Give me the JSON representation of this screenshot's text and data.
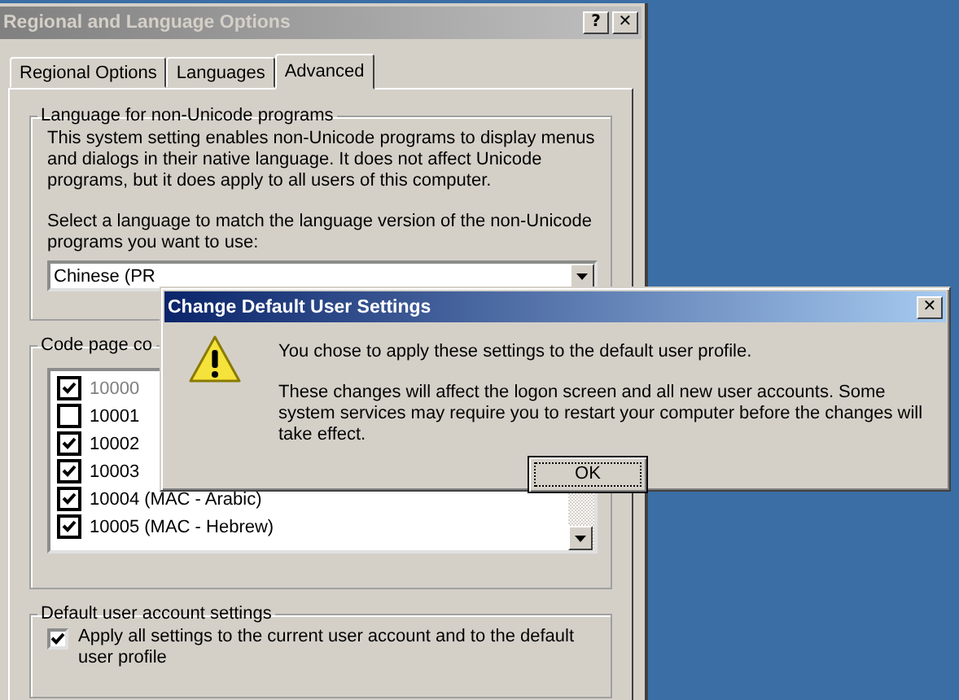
{
  "window": {
    "title": "Regional and Language Options",
    "help_button": "?",
    "close_button": "✕"
  },
  "tabs": [
    {
      "label": "Regional Options",
      "selected": false
    },
    {
      "label": "Languages",
      "selected": false
    },
    {
      "label": "Advanced",
      "selected": true
    }
  ],
  "non_unicode_group": {
    "title": "Language for non-Unicode programs",
    "description": "This system setting enables non-Unicode programs to display menus and dialogs in their native language. It does not affect Unicode programs, but it does apply to all users of this computer.",
    "prompt": "Select a language to match the language version of the non-Unicode programs you want to use:",
    "language_value": "Chinese (PR"
  },
  "code_page_group": {
    "title": "Code page co",
    "rows": [
      {
        "label": "10000",
        "checked": true,
        "disabled": true
      },
      {
        "label": "10001",
        "checked": false,
        "disabled": false
      },
      {
        "label": "10002",
        "checked": true,
        "disabled": false
      },
      {
        "label": "10003",
        "checked": true,
        "disabled": false
      },
      {
        "label": "10004 (MAC - Arabic)",
        "checked": true,
        "disabled": false
      },
      {
        "label": "10005 (MAC - Hebrew)",
        "checked": true,
        "disabled": false
      }
    ]
  },
  "default_user_group": {
    "title": "Default user account settings",
    "option": {
      "label": "Apply all settings to the current user account and to the default user profile",
      "checked": true
    }
  },
  "dialog": {
    "title": "Change Default User Settings",
    "close_button": "✕",
    "message": "You chose to apply these settings to the default user profile.",
    "detail": "These changes will affect the logon screen and all new user accounts. Some system services may require you to restart your computer before the changes will take effect.",
    "buttons": [
      "OK"
    ]
  }
}
